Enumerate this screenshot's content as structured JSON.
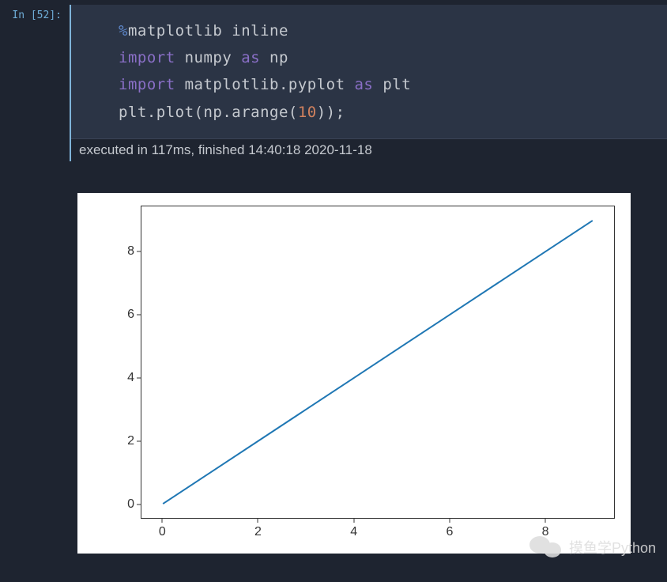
{
  "prompt_label": "In [52]:",
  "code": {
    "line1_magic": "%",
    "line1_rest": "matplotlib inline",
    "line2_import": "import",
    "line2_mod": " numpy ",
    "line2_as": "as",
    "line2_alias": " np",
    "line3_import": "import",
    "line3_mod": " matplotlib.pyplot ",
    "line3_as": "as",
    "line3_alias": " plt",
    "line4_part1": "plt.plot(np.arange(",
    "line4_num": "10",
    "line4_part2": "));"
  },
  "exec_info": "executed in 117ms, finished 14:40:18 2020-11-18",
  "chart_data": {
    "type": "line",
    "x": [
      0,
      1,
      2,
      3,
      4,
      5,
      6,
      7,
      8,
      9
    ],
    "y": [
      0,
      1,
      2,
      3,
      4,
      5,
      6,
      7,
      8,
      9
    ],
    "xticks": [
      0,
      2,
      4,
      6,
      8
    ],
    "yticks": [
      0,
      2,
      4,
      6,
      8
    ],
    "xlim": [
      -0.45,
      9.45
    ],
    "ylim": [
      -0.45,
      9.45
    ],
    "line_color": "#1f77b4",
    "title": "",
    "xlabel": "",
    "ylabel": ""
  },
  "watermark_text": "摸鱼学Python"
}
